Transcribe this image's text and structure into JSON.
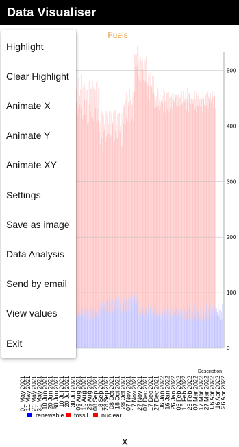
{
  "app": {
    "title": "Data Visualiser"
  },
  "menu": {
    "items": [
      {
        "label": "Highlight"
      },
      {
        "label": "Clear Highlight"
      },
      {
        "label": "Animate X"
      },
      {
        "label": "Animate Y"
      },
      {
        "label": "Animate XY"
      },
      {
        "label": "Settings"
      },
      {
        "label": "Save as image"
      },
      {
        "label": "Data Analysis"
      },
      {
        "label": "Send by email"
      },
      {
        "label": "View values"
      },
      {
        "label": "Exit"
      }
    ]
  },
  "footer": {
    "x_label": "X"
  },
  "chart_data": {
    "type": "bar",
    "title": "Fuels",
    "description": "Description",
    "y_ticks": [
      "0",
      "100",
      "200",
      "300",
      "400",
      "500"
    ],
    "ylim": [
      0,
      550
    ],
    "grid": true,
    "stacked": true,
    "legend_position": "bottom-left",
    "x_tick_labels": [
      "01 May 2021",
      "11 May 2021",
      "21 May 2021",
      "31 May 2021",
      "10 Jun 2021",
      "20 Jun 2021",
      "30 Jun 2021",
      "10 Jul 2021",
      "20 Jul 2021",
      "30 Jul 2021",
      "09 Aug 2021",
      "19 Aug 2021",
      "29 Aug 2021",
      "08 Sep 2021",
      "18 Sep 2021",
      "28 Sep 2021",
      "08 Oct 2021",
      "18 Oct 2021",
      "28 Oct 2021",
      "07 Nov 2021",
      "17 Nov 2021",
      "27 Nov 2021",
      "07 Dec 2021",
      "17 Dec 2021",
      "27 Dec 2021",
      "06 Jan 2022",
      "16 Jan 2022",
      "26 Jan 2022",
      "05 Feb 2022",
      "15 Feb 2022",
      "25 Feb 2022",
      "07 Mar 2022",
      "17 Mar 2022",
      "27 Mar 2022",
      "06 Apr 2022",
      "16 Apr 2022",
      "26 Apr 2022"
    ],
    "x_start": "01 May 2021",
    "x_end": "30 Apr 2022",
    "series": [
      {
        "name": "renewable",
        "color": "#0000ff",
        "bar_color": "#b8b8ff",
        "values": [
          62,
          55,
          70,
          48,
          80,
          66,
          58,
          72,
          50,
          64,
          75,
          60,
          68,
          52,
          78,
          63,
          57,
          71,
          49,
          67,
          73,
          59,
          65,
          54,
          76,
          62,
          56,
          70,
          51,
          69,
          74,
          61,
          66,
          53,
          79,
          64,
          58,
          72,
          50,
          68,
          75,
          60,
          67,
          52,
          77,
          63,
          57,
          71,
          49,
          66,
          73,
          59,
          65,
          55,
          80,
          62,
          56,
          70,
          51,
          69,
          88,
          74,
          82,
          66,
          90,
          78,
          70,
          84,
          64,
          86,
          92,
          72,
          80,
          68,
          88,
          76,
          70,
          84,
          62,
          86,
          90,
          74,
          82,
          66,
          94,
          78,
          72,
          85,
          64,
          87,
          93,
          73,
          81,
          67,
          89,
          77,
          71,
          83,
          63,
          85,
          91,
          75,
          82,
          68,
          92,
          79,
          72,
          86,
          65,
          88,
          95,
          74,
          81,
          67,
          90,
          78,
          70,
          84,
          62,
          87,
          98,
          76,
          84,
          68,
          93,
          80,
          73,
          86,
          66,
          89,
          96,
          75,
          83,
          69,
          91,
          79,
          72,
          85,
          64,
          88,
          97,
          77,
          84,
          70,
          94,
          81,
          74,
          87,
          67,
          90,
          99,
          78,
          86,
          71,
          95,
          82,
          75,
          88,
          68,
          91,
          62,
          55,
          70,
          48,
          80,
          66,
          58,
          72,
          50,
          64,
          75,
          60,
          68,
          52,
          78,
          63,
          57,
          71,
          49,
          67,
          73,
          59,
          65,
          54,
          76,
          62,
          56,
          70,
          51,
          69,
          74,
          61,
          66,
          53,
          79,
          64,
          58,
          72,
          50,
          68,
          75,
          60,
          67,
          52,
          77,
          63,
          57,
          71,
          49,
          66,
          73,
          59,
          65,
          55,
          80,
          62,
          56,
          70,
          51,
          69,
          74,
          61,
          66,
          53,
          79,
          64,
          58,
          72,
          50,
          68,
          75,
          60,
          67,
          52,
          77,
          63,
          57,
          71,
          49,
          66,
          73,
          59,
          65,
          55,
          80,
          62,
          56,
          70,
          51,
          69,
          74,
          61,
          66,
          53,
          79,
          64,
          58,
          72,
          50,
          68,
          75,
          60,
          67,
          52,
          77,
          63,
          57,
          71,
          49,
          66,
          73,
          59,
          65,
          55,
          80,
          62,
          56,
          70,
          51,
          69,
          74,
          61,
          66,
          53,
          79,
          64,
          58,
          72,
          50,
          68,
          75,
          60,
          67,
          52,
          77,
          63,
          57,
          71,
          49,
          66,
          73,
          59,
          65,
          55,
          80,
          62,
          56,
          70,
          51,
          69,
          74,
          61,
          66,
          53,
          79,
          64,
          58,
          72,
          50,
          68,
          75,
          60,
          67,
          52,
          77,
          63,
          57,
          71,
          49,
          66,
          73,
          59,
          65,
          55,
          80,
          62,
          56,
          70,
          51,
          69,
          74,
          61,
          66,
          53,
          79,
          64,
          58,
          72,
          50,
          68,
          75,
          60,
          67,
          52,
          77,
          63,
          57,
          71,
          49,
          66,
          73,
          59,
          65,
          55,
          80,
          62,
          56,
          70,
          51,
          69,
          74,
          61,
          66,
          53,
          79
        ]
      },
      {
        "name": "fossil",
        "color": "#ff0000",
        "bar_color": "#ffb8b8",
        "values": [
          380,
          410,
          360,
          395,
          340,
          420,
          375,
          400,
          350,
          390,
          365,
          405,
          345,
          385,
          415,
          370,
          355,
          398,
          372,
          402,
          338,
          388,
          412,
          366,
          392,
          344,
          408,
          378,
          352,
          396,
          362,
          418,
          342,
          386,
          404,
          368,
          356,
          394,
          376,
          400,
          340,
          390,
          414,
          364,
          394,
          346,
          410,
          380,
          350,
          398,
          360,
          420,
          344,
          384,
          402,
          370,
          354,
          396,
          374,
          404,
          302,
          332,
          286,
          338,
          294,
          350,
          308,
          340,
          290,
          330,
          298,
          346,
          312,
          336,
          288,
          352,
          300,
          342,
          318,
          334,
          296,
          344,
          306,
          338,
          292,
          348,
          304,
          332,
          316,
          340,
          290,
          350,
          302,
          336,
          320,
          346,
          294,
          338,
          310,
          344,
          300,
          354,
          314,
          334,
          288,
          342,
          306,
          340,
          322,
          336,
          296,
          350,
          308,
          332,
          318,
          346,
          292,
          340,
          304,
          338,
          346,
          360,
          320,
          370,
          338,
          380,
          330,
          362,
          348,
          372,
          336,
          378,
          326,
          366,
          352,
          374,
          334,
          382,
          342,
          358,
          350,
          376,
          328,
          368,
          344,
          380,
          336,
          364,
          354,
          372,
          430,
          450,
          420,
          460,
          410,
          446,
          436,
          456,
          418,
          452,
          428,
          462,
          412,
          448,
          438,
          458,
          420,
          444,
          432,
          454,
          426,
          460,
          414,
          450,
          440,
          456,
          422,
          446,
          434,
          458,
          402,
          420,
          388,
          424,
          396,
          430,
          406,
          418,
          392,
          428,
          398,
          434,
          408,
          420,
          390,
          426,
          400,
          432,
          410,
          422,
          380,
          372,
          396,
          384,
          368,
          390,
          376,
          398,
          386,
          370,
          392,
          378,
          382,
          374,
          388,
          394,
          380,
          372,
          396,
          384,
          378,
          382,
          388,
          372,
          392,
          376,
          384,
          390,
          374,
          380,
          370,
          386,
          392,
          378,
          382,
          374,
          388,
          390,
          376,
          384,
          380,
          372,
          394,
          382,
          376,
          388,
          374,
          386,
          390,
          378,
          384,
          382,
          376,
          388,
          372,
          392,
          378,
          384,
          386,
          374,
          380,
          376,
          390,
          384,
          372,
          388,
          378,
          382,
          386,
          374,
          390,
          380,
          376,
          388,
          382,
          374,
          386,
          378,
          392,
          380,
          388,
          374,
          384,
          376,
          390,
          382,
          378,
          386,
          374,
          392,
          380,
          384,
          376,
          388,
          372,
          386,
          380,
          378,
          390,
          382,
          376,
          384,
          388,
          374,
          382,
          386,
          378,
          390,
          374,
          384,
          380,
          376,
          388,
          382,
          386,
          374,
          390,
          378,
          384,
          380,
          376,
          388,
          382,
          374,
          386,
          378,
          392,
          380,
          388,
          374,
          384,
          376,
          390,
          382,
          378,
          386,
          374,
          392,
          380,
          384,
          376,
          388,
          372,
          386,
          380,
          378,
          390,
          382,
          376,
          384,
          388,
          374,
          382,
          386,
          378,
          390,
          374
        ]
      },
      {
        "name": "nuclear",
        "color": "#ff0000",
        "bar_color": "#ffb8b8",
        "values": []
      }
    ]
  }
}
